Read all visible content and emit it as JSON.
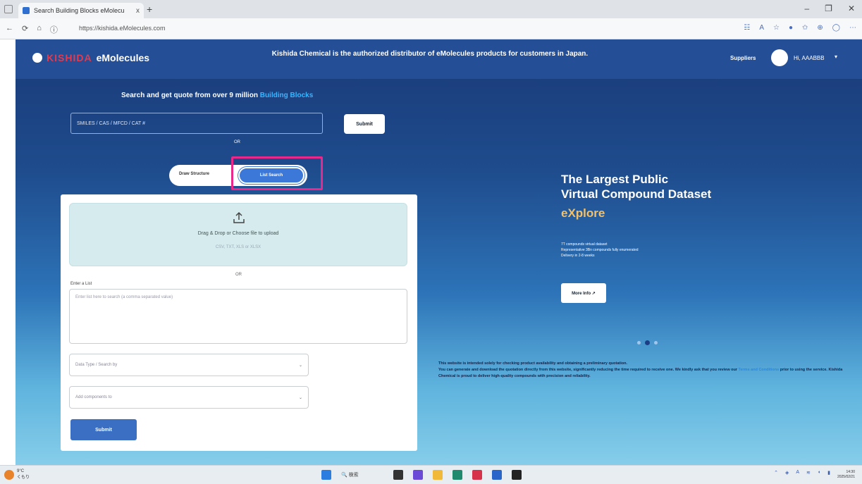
{
  "browser": {
    "tab_title": "Search Building Blocks eMolecu",
    "tab_close": "x",
    "new_tab": "+",
    "url": "https://kishida.eMolecules.com",
    "window_controls": [
      "–",
      "❐",
      "✕"
    ]
  },
  "header": {
    "logo_brand": "KISHIDA",
    "logo_product": "eMolecules",
    "banner": "Kishida Chemical is the authorized distributor of eMolecules products for customers in Japan.",
    "suppliers_link": "Suppliers",
    "user_greeting": "Hi, AAABBB"
  },
  "search": {
    "heading_prefix": "Search and get quote from over 9 million",
    "heading_highlight": "Building Blocks",
    "input_placeholder": "SMILES / CAS / MFCD / CAT #",
    "submit_label": "Submit",
    "or_label": "OR",
    "toggle_draw": "Draw Structure",
    "toggle_list": "List Search"
  },
  "list_search": {
    "dropzone_title": "Drag & Drop or Choose file to upload",
    "dropzone_formats": "CSV, TXT, XLS or XLSX",
    "or_label": "OR",
    "list_label": "Enter a List",
    "list_placeholder": "Enter list here to search (a comma separated value)",
    "data_type_placeholder": "Data Type / Search by",
    "add_components_placeholder": "Add components to",
    "submit_label": "Submit"
  },
  "hero": {
    "title_line1": "The Largest Public",
    "title_line2": "Virtual Compound Dataset",
    "accent": "eXplore",
    "desc_line1": "7T compounds virtual dataset",
    "desc_line2": "Representative 3Bn compounds fully enumerated",
    "desc_line3": "Delivery in 2-8 weeks",
    "more_info_label": "More Info ↗",
    "slide_count": 3,
    "active_slide": 2
  },
  "disclaimer": {
    "line1": "This website is intended solely for checking product availability and obtaining a preliminary quotation.",
    "line2_pre": "You can generate and download the quotation directly from this website, significantly reducing the time required to receive one. We kindly ask that you review our",
    "link": "Terms and Conditions",
    "line2_post": "prior to using the service. Kishida Chemical is proud to deliver high-quality compounds with precision and reliability."
  },
  "taskbar": {
    "weather_temp": "9°C",
    "weather_desc": "くもり",
    "search_label": "検索",
    "clock_time": "14:30",
    "clock_date": "2025/02/21"
  },
  "colors": {
    "brand_red": "#e43a4f",
    "accent_blue": "#3c78d8",
    "highlight_pink": "#e8298b",
    "hero_accent": "#f2c06a"
  }
}
